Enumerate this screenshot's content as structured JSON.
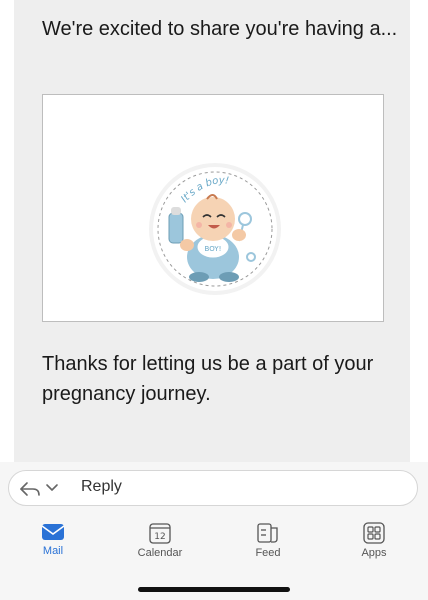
{
  "email": {
    "intro_text": "We're excited to share you're having a...",
    "outro_text": "Thanks for letting us be a part of your pregnancy journey.",
    "sticker": {
      "top_text": "It's a boy!",
      "bib_text": "BOY!"
    }
  },
  "reply": {
    "label": "Reply"
  },
  "nav": {
    "items": [
      {
        "label": "Mail",
        "icon": "mail-icon",
        "active": true
      },
      {
        "label": "Calendar",
        "icon": "calendar-icon",
        "badge": "12"
      },
      {
        "label": "Feed",
        "icon": "feed-icon"
      },
      {
        "label": "Apps",
        "icon": "apps-icon"
      }
    ]
  },
  "colors": {
    "accent": "#2a72d6",
    "card_bg": "#eeeeee",
    "baby_blue": "#9cc6dc"
  }
}
